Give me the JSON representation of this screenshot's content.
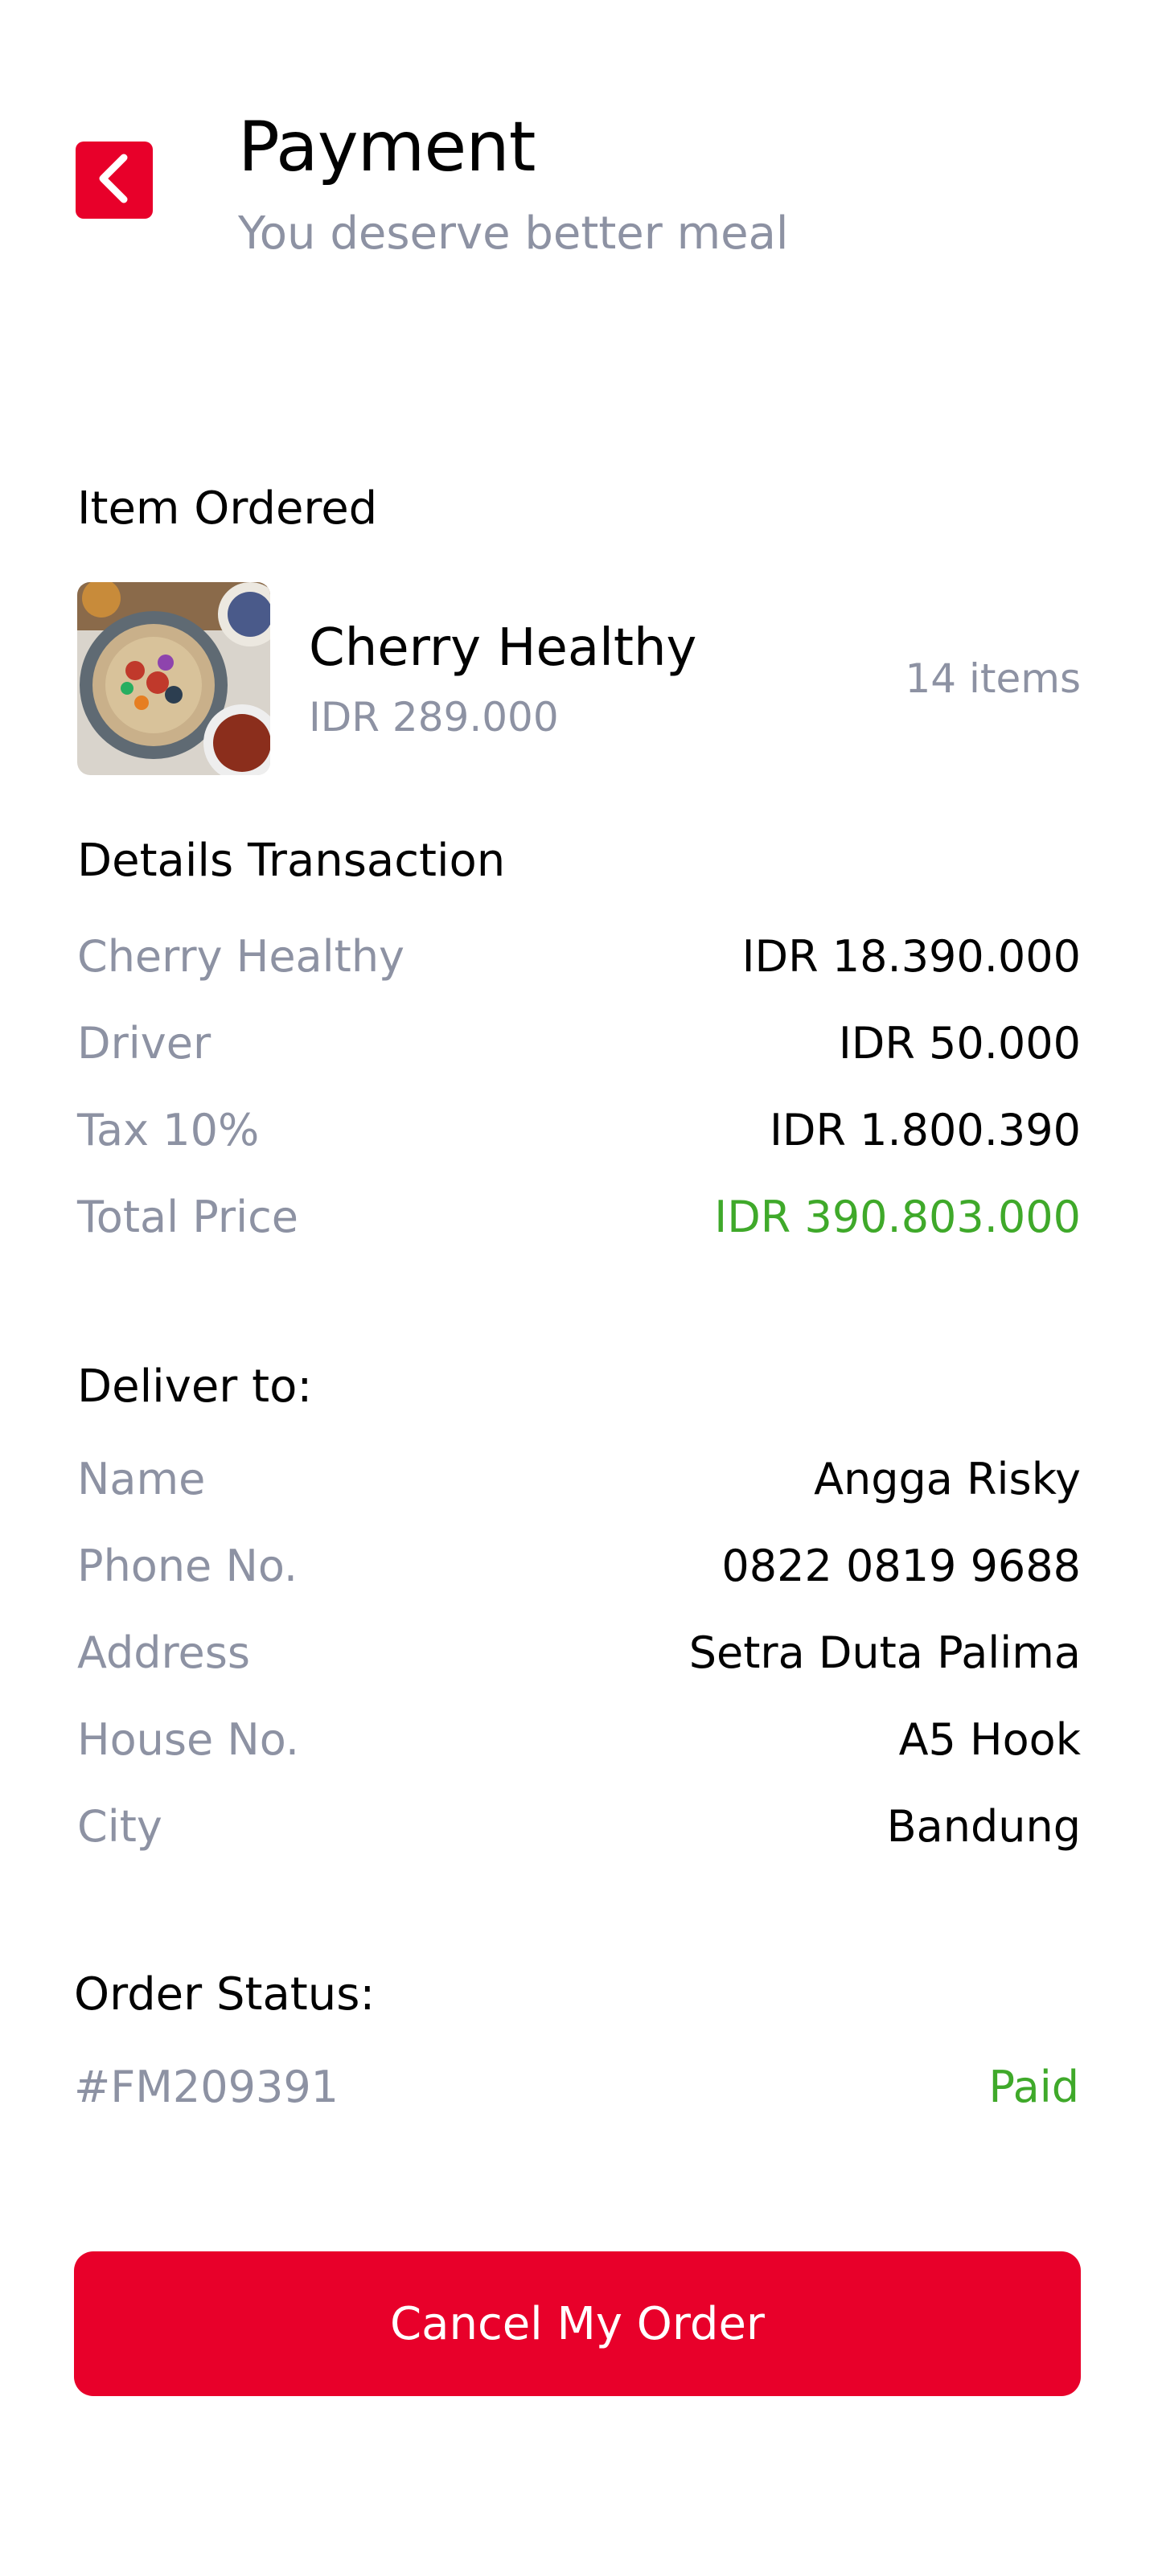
{
  "header": {
    "title": "Payment",
    "subtitle": "You deserve better meal",
    "back_icon": "chevron-left-icon"
  },
  "item_ordered": {
    "section_title": "Item Ordered",
    "name": "Cherry Healthy",
    "price": "IDR 289.000",
    "count": "14 items"
  },
  "details_transaction": {
    "section_title": "Details Transaction",
    "rows": [
      {
        "label": "Cherry Healthy",
        "value": "IDR 18.390.000"
      },
      {
        "label": "Driver",
        "value": "IDR 50.000"
      },
      {
        "label": "Tax 10%",
        "value": "IDR 1.800.390"
      },
      {
        "label": "Total Price",
        "value": "IDR 390.803.000"
      }
    ]
  },
  "deliver_to": {
    "section_title": "Deliver to:",
    "rows": [
      {
        "label": "Name",
        "value": "Angga Risky"
      },
      {
        "label": "Phone No.",
        "value": "0822 0819 9688"
      },
      {
        "label": "Address",
        "value": "Setra Duta Palima"
      },
      {
        "label": "House No.",
        "value": "A5 Hook"
      },
      {
        "label": "City",
        "value": "Bandung"
      }
    ]
  },
  "order_status": {
    "section_title": "Order Status:",
    "order_id": "#FM209391",
    "status": "Paid"
  },
  "actions": {
    "cancel_label": "Cancel My Order"
  },
  "colors": {
    "brand_red": "#E8002A",
    "muted_gray": "#8D92A3",
    "success_green": "#3FA92A"
  }
}
